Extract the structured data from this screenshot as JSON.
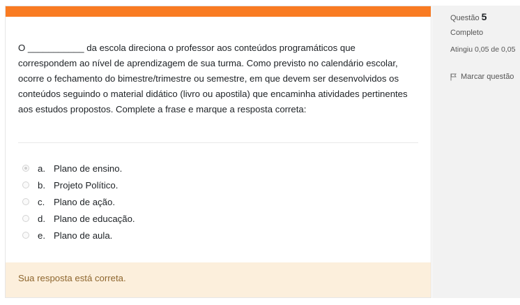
{
  "question": {
    "text": "O ___________ da escola direciona o professor aos conteúdos programáticos que correspondem ao nível de aprendizagem de sua turma. Como previsto no calendário escolar, ocorre o fechamento do bimestre/trimestre ou semestre, em que devem ser desenvolvidos os conteúdos seguindo o material didático (livro ou apostila) que encaminha atividades pertinentes aos estudos propostos. Complete a frase e marque a resposta correta:"
  },
  "options": [
    {
      "letter": "a.",
      "label": "Plano de ensino.",
      "selected": true
    },
    {
      "letter": "b.",
      "label": "Projeto Político.",
      "selected": false
    },
    {
      "letter": "c.",
      "label": "Plano de ação.",
      "selected": false
    },
    {
      "letter": "d.",
      "label": "Plano de educação.",
      "selected": false
    },
    {
      "letter": "e.",
      "label": "Plano de aula.",
      "selected": false
    }
  ],
  "feedback": "Sua resposta está correta.",
  "info": {
    "question_label": "Questão",
    "question_number": "5",
    "state": "Completo",
    "grade": "Atingiu 0,05 de 0,05",
    "flag_label": "Marcar questão"
  },
  "colors": {
    "accent": "#f97b22",
    "feedback_bg": "#fcefdc",
    "feedback_text": "#8e662e"
  }
}
